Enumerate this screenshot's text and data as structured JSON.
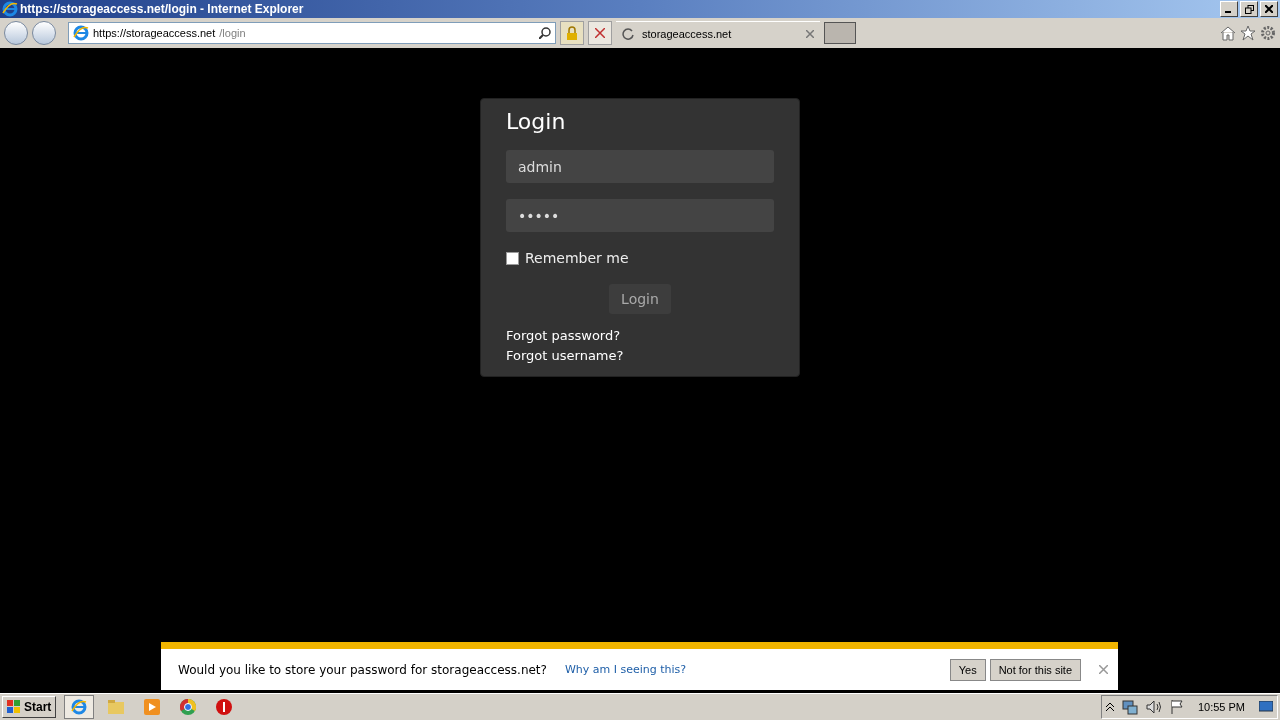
{
  "window": {
    "title": "https://storageaccess.net/login - Internet Explorer"
  },
  "address_bar": {
    "host": "https://storageaccess.net",
    "path": "/login"
  },
  "tabs": [
    {
      "label": "storageaccess.net",
      "selected": true,
      "loading": true
    }
  ],
  "login": {
    "title": "Login",
    "username": "admin",
    "password": "•••••",
    "remember_label": "Remember me",
    "remember_checked": false,
    "button": "Login",
    "links": [
      "Forgot password?",
      "Forgot username?"
    ]
  },
  "notification": {
    "message": "Would you like to store your password for storageaccess.net?",
    "link": "Why am I seeing this?",
    "buttons": [
      "Yes",
      "Not for this site"
    ]
  },
  "taskbar": {
    "start": "Start",
    "clock": "10:55 PM"
  }
}
